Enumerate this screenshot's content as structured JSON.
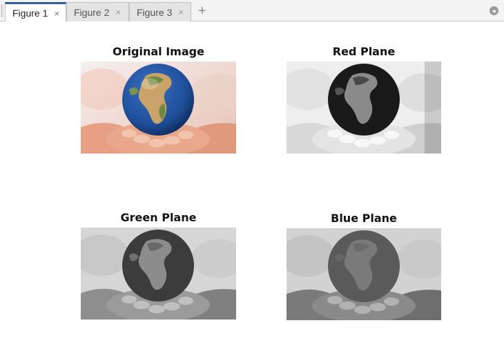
{
  "tabs": [
    {
      "label": "Figure 1",
      "active": true
    },
    {
      "label": "Figure 2",
      "active": false
    },
    {
      "label": "Figure 3",
      "active": false
    }
  ],
  "tab_close_glyph": "×",
  "new_tab_glyph": "+",
  "icons": {
    "close": "close-icon",
    "add": "plus-icon",
    "menu": "chevron-down-circle-icon"
  },
  "subplots": [
    {
      "title": "Original Image",
      "color_mode": "rgb"
    },
    {
      "title": "Red Plane",
      "color_mode": "grayscale"
    },
    {
      "title": "Green Plane",
      "color_mode": "grayscale"
    },
    {
      "title": "Blue Plane",
      "color_mode": "grayscale"
    }
  ],
  "colors": {
    "active_tab_accent": "#2f5c9e",
    "ocean": "#1f4f9a",
    "land": "#6f8a3e",
    "desert": "#c9a36a",
    "skin": "#e39a7a"
  }
}
